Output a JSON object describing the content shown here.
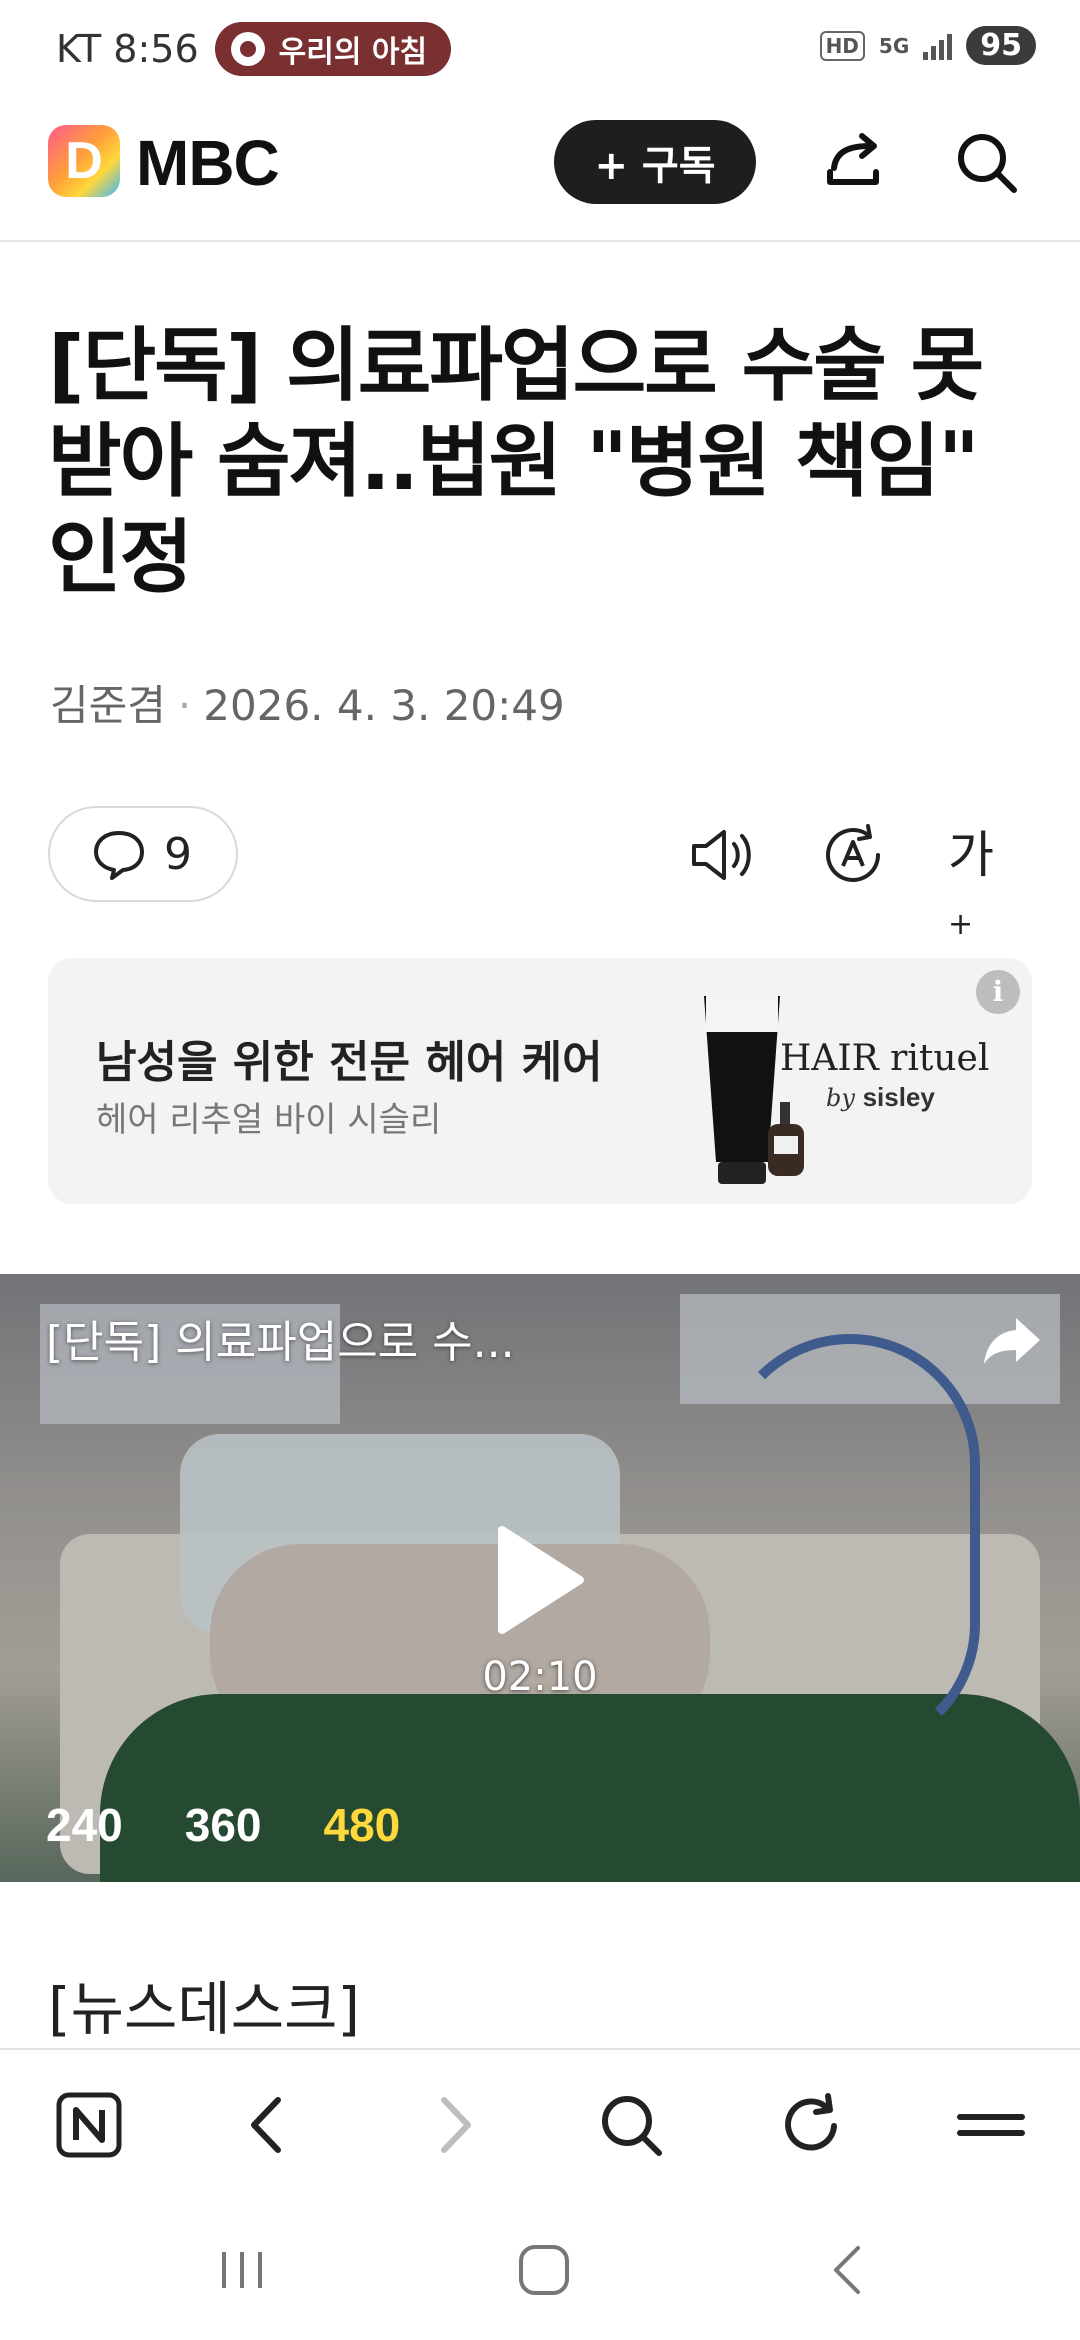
{
  "status_bar": {
    "carrier": "KT",
    "time": "8:56",
    "live_pill": "우리의 아침",
    "hd": "HD",
    "network": "5G",
    "battery": "95"
  },
  "header": {
    "logo_letter": "D",
    "brand": "MBC",
    "subscribe_label": "+ 구독"
  },
  "article": {
    "headline": "[단독] 의료파업으로 수술 못받아 숨져..법원 \"병원 책임\" 인정",
    "author": "김준겸",
    "separator": "·",
    "published": "2026. 4. 3. 20:49",
    "comment_count": "9",
    "font_size_icon_label": "가"
  },
  "ad": {
    "title": "남성을 위한 전문 헤어 케어",
    "subtitle": "헤어 리추얼 바이 시슬리",
    "info": "i",
    "brand_name": "HAIR rituel",
    "brand_by": "by",
    "brand_house": "sisley"
  },
  "video": {
    "title": "[단독] 의료파업으로 수...",
    "duration": "02:10",
    "qualities": [
      "240",
      "360",
      "480"
    ],
    "selected_quality": "480"
  },
  "section_label": "[뉴스데스크]",
  "colors": {
    "pill_bg": "#7a2f31",
    "subscribe_bg": "#1e1e1e",
    "quality_active": "#ffd93b",
    "ad_bg": "#f3f3f3"
  },
  "icons": {
    "header": [
      "share-icon",
      "search-icon"
    ],
    "tools": [
      "comment-icon",
      "speaker-icon",
      "auto-translate-icon",
      "font-size-icon"
    ],
    "browser": [
      "naver-home-icon",
      "back-icon",
      "forward-icon",
      "search-icon",
      "refresh-icon",
      "menu-icon"
    ],
    "nav": [
      "recent-apps-icon",
      "home-icon",
      "system-back-icon"
    ]
  }
}
